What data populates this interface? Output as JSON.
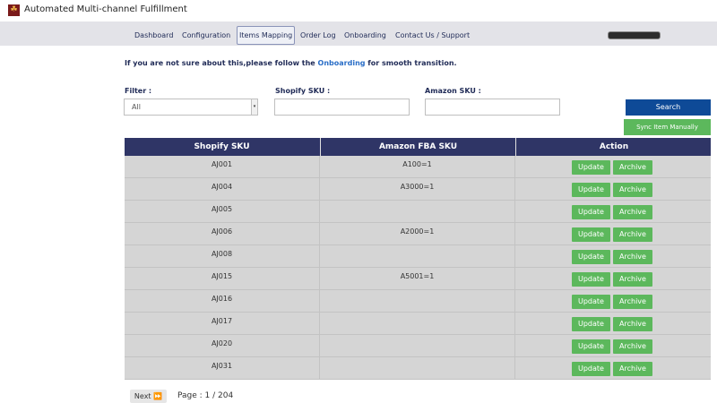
{
  "app": {
    "title": "Automated Multi-channel Fulfillment",
    "logo_glyph": "☘"
  },
  "nav": {
    "items": [
      {
        "label": "Dashboard"
      },
      {
        "label": "Configuration"
      },
      {
        "label": "Items Mapping",
        "active": true
      },
      {
        "label": "Order Log"
      },
      {
        "label": "Onboarding"
      },
      {
        "label": "Contact Us / Support"
      }
    ]
  },
  "notice": {
    "prefix": "If you are not sure about this,please follow the",
    "link": "Onboarding",
    "suffix": "for smooth transition."
  },
  "filters": {
    "filter_label": "Filter :",
    "filter_value": "All",
    "shopify_label": "Shopify SKU :",
    "shopify_value": "",
    "amazon_label": "Amazon SKU :",
    "amazon_value": ""
  },
  "buttons": {
    "search": "Search",
    "sync": "Sync Item Manually",
    "next": "Next ⏩"
  },
  "table": {
    "headers": [
      "Shopify SKU",
      "Amazon FBA SKU",
      "Action"
    ],
    "update_label": "Update",
    "archive_label": "Archive",
    "rows": [
      {
        "shopify": "AJ001",
        "amazon": "A100=1"
      },
      {
        "shopify": "AJ004",
        "amazon": "A3000=1"
      },
      {
        "shopify": "AJ005",
        "amazon": ""
      },
      {
        "shopify": "AJ006",
        "amazon": "A2000=1"
      },
      {
        "shopify": "AJ008",
        "amazon": ""
      },
      {
        "shopify": "AJ015",
        "amazon": "A5001=1"
      },
      {
        "shopify": "AJ016",
        "amazon": ""
      },
      {
        "shopify": "AJ017",
        "amazon": ""
      },
      {
        "shopify": "AJ020",
        "amazon": ""
      },
      {
        "shopify": "AJ031",
        "amazon": ""
      }
    ]
  },
  "pagination": {
    "text": "Page : 1 / 204"
  },
  "colors": {
    "header_bg": "#2f3566",
    "search_btn": "#0e4a97",
    "action_btn": "#5cb85c",
    "link": "#2a6ec7"
  }
}
